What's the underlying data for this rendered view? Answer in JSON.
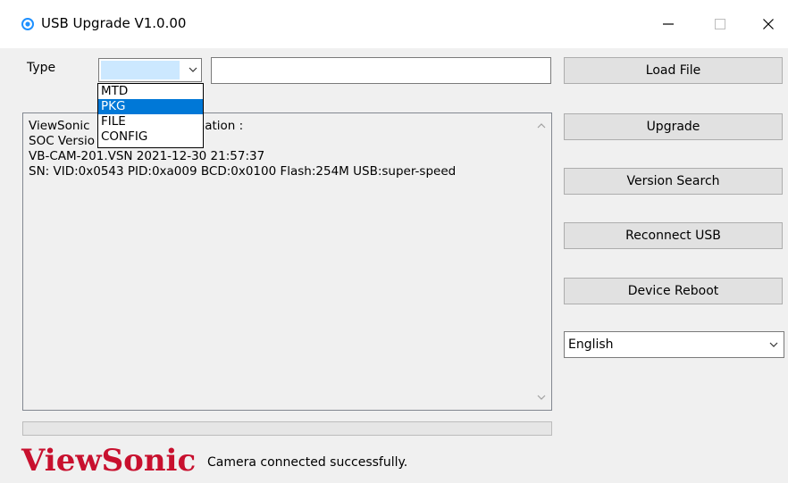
{
  "window": {
    "title": "USB Upgrade V1.0.00",
    "controls": {
      "minimize": "minimize-icon",
      "maximize": "maximize-icon",
      "close": "close-icon"
    }
  },
  "type_row": {
    "label": "Type",
    "selected": "",
    "file_path": "",
    "dropdown_options": [
      "MTD",
      "PKG",
      "FILE",
      "CONFIG"
    ],
    "highlighted_option": "PKG"
  },
  "buttons": {
    "load_file": "Load File",
    "upgrade": "Upgrade",
    "version_search": "Version Search",
    "reconnect_usb": "Reconnect USB",
    "device_reboot": "Device Reboot"
  },
  "info": {
    "lines": [
      "ViewSonic          ncam Information :",
      "SOC Versio",
      "VB-CAM-201.VSN 2021-12-30 21:57:37",
      "SN: VID:0x0543 PID:0xa009 BCD:0x0100 Flash:254M USB:super-speed"
    ]
  },
  "language": {
    "selected": "English"
  },
  "progress": {
    "value": 0
  },
  "footer": {
    "logo_text": "ViewSonic",
    "status": "Camera connected successfully."
  },
  "colors": {
    "selection": "#0078d7",
    "combo_highlight": "#cce8ff",
    "logo_red": "#c8102e",
    "app_icon": "#1e90ff"
  }
}
